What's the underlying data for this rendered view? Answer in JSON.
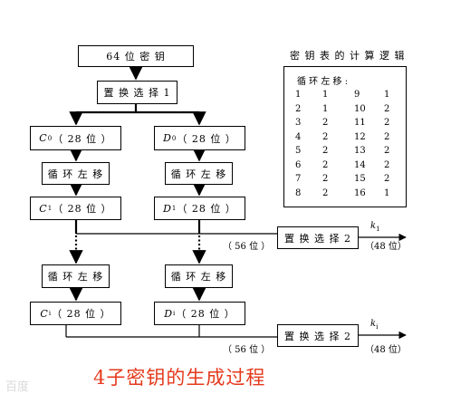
{
  "title_box": "64 位 密 钥",
  "pc1_box": "置 换 选 择 1",
  "c0": {
    "letter": "C",
    "sub": "0",
    "bits": "（ 28 位 ）"
  },
  "d0": {
    "letter": "D",
    "sub": "0",
    "bits": "（ 28 位 ）"
  },
  "shift_left_1": "循 环 左 移",
  "shift_right_1": "循 环 左 移",
  "c1": {
    "letter": "C",
    "sub": "1",
    "bits": "（ 28 位 ）"
  },
  "d1": {
    "letter": "D",
    "sub": "1",
    "bits": "（ 28 位 ）"
  },
  "pc2_box_1": "置 换 选 择 2",
  "pc2_in_1": "（ 56 位 ）",
  "k1": {
    "letter": "k",
    "sub": "1",
    "bits": "（48 位）"
  },
  "shift_left_i": "循 环 左 移",
  "shift_right_i": "循 环 左 移",
  "ci": {
    "letter": "C",
    "sub": "i",
    "bits": "（ 28 位 ）"
  },
  "di": {
    "letter": "D",
    "sub": "i",
    "bits": "（ 28 位 ）"
  },
  "pc2_box_2": "置 换 选 择 2",
  "pc2_in_2": "（ 56 位 ）",
  "ki": {
    "letter": "k",
    "sub": "i",
    "bits": "（48 位）"
  },
  "table": {
    "heading": "密 钥 表 的 计 算 逻 辑",
    "subheading": "循 环 左 移 :",
    "rows": [
      [
        "1",
        "1",
        "9",
        "1"
      ],
      [
        "2",
        "1",
        "10",
        "2"
      ],
      [
        "3",
        "2",
        "11",
        "2"
      ],
      [
        "4",
        "2",
        "12",
        "2"
      ],
      [
        "5",
        "2",
        "13",
        "2"
      ],
      [
        "6",
        "2",
        "14",
        "2"
      ],
      [
        "7",
        "2",
        "15",
        "2"
      ],
      [
        "8",
        "2",
        "16",
        "1"
      ]
    ]
  },
  "caption": "4子密钥的生成过程",
  "watermark": "百度"
}
